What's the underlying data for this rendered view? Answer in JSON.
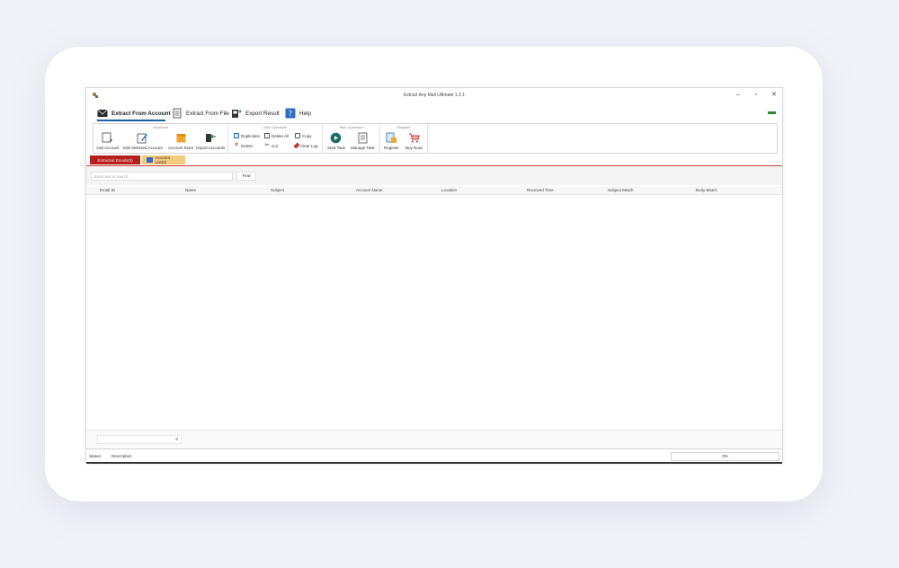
{
  "window": {
    "title": "Extract Any Mail Ultimate 1.2.1",
    "controls": {
      "minimize": "–",
      "maximize": "▫",
      "close": "✕"
    }
  },
  "menu": {
    "items": [
      {
        "label": "Extract From Account",
        "icon": "envelope-icon"
      },
      {
        "label": "Extract From File",
        "icon": "document-icon"
      },
      {
        "label": "Export Result",
        "icon": "export-icon"
      },
      {
        "label": "Help",
        "icon": "help-icon"
      }
    ]
  },
  "ribbon": {
    "accounts": {
      "title": "Accounts",
      "buttons": [
        "Add Account",
        "Edit Selected Account",
        "Account Store",
        "Import Accounts"
      ]
    },
    "grid": {
      "title": "Grid Operation",
      "buttons": [
        "Duplicates",
        "Delete All",
        "Copy",
        "Delete",
        "Cut",
        "Clear Log"
      ]
    },
    "task": {
      "title": "Task Operation",
      "buttons": [
        "Start Task",
        "Manage Task"
      ]
    },
    "register": {
      "title": "Register",
      "buttons": [
        "Register",
        "Buy Now!"
      ]
    }
  },
  "tabs": {
    "extracted": "Extracted Emails(0)",
    "accounts": "Account List(0)"
  },
  "search": {
    "placeholder": "Enter text to search...",
    "find_label": "Find"
  },
  "grid": {
    "columns": [
      "Email ID",
      "Name",
      "Subject",
      "Account Name",
      "Location",
      "Received Time",
      "Subject Match",
      "Body Match"
    ]
  },
  "pager": {
    "value": "0"
  },
  "status": {
    "label": "Status:",
    "description": "Description",
    "progress": "0%"
  },
  "colors": {
    "accent": "#1f5fa5",
    "tab_red": "#b51f1f",
    "tab_yellow": "#f7c97a"
  }
}
